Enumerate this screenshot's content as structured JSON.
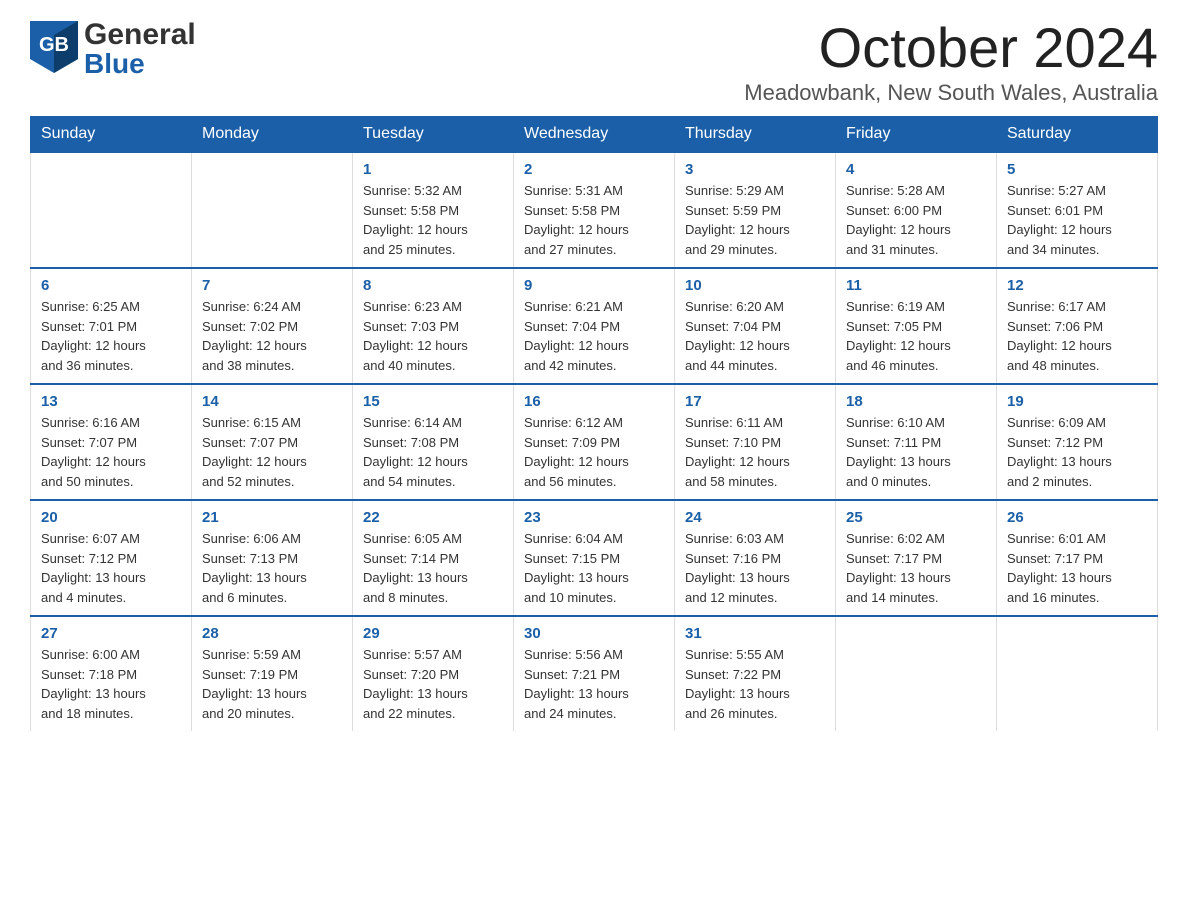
{
  "header": {
    "logo_general": "General",
    "logo_blue": "Blue",
    "month_title": "October 2024",
    "location": "Meadowbank, New South Wales, Australia"
  },
  "days_of_week": [
    "Sunday",
    "Monday",
    "Tuesday",
    "Wednesday",
    "Thursday",
    "Friday",
    "Saturday"
  ],
  "weeks": [
    {
      "days": [
        {
          "number": "",
          "info": ""
        },
        {
          "number": "",
          "info": ""
        },
        {
          "number": "1",
          "info": "Sunrise: 5:32 AM\nSunset: 5:58 PM\nDaylight: 12 hours\nand 25 minutes."
        },
        {
          "number": "2",
          "info": "Sunrise: 5:31 AM\nSunset: 5:58 PM\nDaylight: 12 hours\nand 27 minutes."
        },
        {
          "number": "3",
          "info": "Sunrise: 5:29 AM\nSunset: 5:59 PM\nDaylight: 12 hours\nand 29 minutes."
        },
        {
          "number": "4",
          "info": "Sunrise: 5:28 AM\nSunset: 6:00 PM\nDaylight: 12 hours\nand 31 minutes."
        },
        {
          "number": "5",
          "info": "Sunrise: 5:27 AM\nSunset: 6:01 PM\nDaylight: 12 hours\nand 34 minutes."
        }
      ]
    },
    {
      "days": [
        {
          "number": "6",
          "info": "Sunrise: 6:25 AM\nSunset: 7:01 PM\nDaylight: 12 hours\nand 36 minutes."
        },
        {
          "number": "7",
          "info": "Sunrise: 6:24 AM\nSunset: 7:02 PM\nDaylight: 12 hours\nand 38 minutes."
        },
        {
          "number": "8",
          "info": "Sunrise: 6:23 AM\nSunset: 7:03 PM\nDaylight: 12 hours\nand 40 minutes."
        },
        {
          "number": "9",
          "info": "Sunrise: 6:21 AM\nSunset: 7:04 PM\nDaylight: 12 hours\nand 42 minutes."
        },
        {
          "number": "10",
          "info": "Sunrise: 6:20 AM\nSunset: 7:04 PM\nDaylight: 12 hours\nand 44 minutes."
        },
        {
          "number": "11",
          "info": "Sunrise: 6:19 AM\nSunset: 7:05 PM\nDaylight: 12 hours\nand 46 minutes."
        },
        {
          "number": "12",
          "info": "Sunrise: 6:17 AM\nSunset: 7:06 PM\nDaylight: 12 hours\nand 48 minutes."
        }
      ]
    },
    {
      "days": [
        {
          "number": "13",
          "info": "Sunrise: 6:16 AM\nSunset: 7:07 PM\nDaylight: 12 hours\nand 50 minutes."
        },
        {
          "number": "14",
          "info": "Sunrise: 6:15 AM\nSunset: 7:07 PM\nDaylight: 12 hours\nand 52 minutes."
        },
        {
          "number": "15",
          "info": "Sunrise: 6:14 AM\nSunset: 7:08 PM\nDaylight: 12 hours\nand 54 minutes."
        },
        {
          "number": "16",
          "info": "Sunrise: 6:12 AM\nSunset: 7:09 PM\nDaylight: 12 hours\nand 56 minutes."
        },
        {
          "number": "17",
          "info": "Sunrise: 6:11 AM\nSunset: 7:10 PM\nDaylight: 12 hours\nand 58 minutes."
        },
        {
          "number": "18",
          "info": "Sunrise: 6:10 AM\nSunset: 7:11 PM\nDaylight: 13 hours\nand 0 minutes."
        },
        {
          "number": "19",
          "info": "Sunrise: 6:09 AM\nSunset: 7:12 PM\nDaylight: 13 hours\nand 2 minutes."
        }
      ]
    },
    {
      "days": [
        {
          "number": "20",
          "info": "Sunrise: 6:07 AM\nSunset: 7:12 PM\nDaylight: 13 hours\nand 4 minutes."
        },
        {
          "number": "21",
          "info": "Sunrise: 6:06 AM\nSunset: 7:13 PM\nDaylight: 13 hours\nand 6 minutes."
        },
        {
          "number": "22",
          "info": "Sunrise: 6:05 AM\nSunset: 7:14 PM\nDaylight: 13 hours\nand 8 minutes."
        },
        {
          "number": "23",
          "info": "Sunrise: 6:04 AM\nSunset: 7:15 PM\nDaylight: 13 hours\nand 10 minutes."
        },
        {
          "number": "24",
          "info": "Sunrise: 6:03 AM\nSunset: 7:16 PM\nDaylight: 13 hours\nand 12 minutes."
        },
        {
          "number": "25",
          "info": "Sunrise: 6:02 AM\nSunset: 7:17 PM\nDaylight: 13 hours\nand 14 minutes."
        },
        {
          "number": "26",
          "info": "Sunrise: 6:01 AM\nSunset: 7:17 PM\nDaylight: 13 hours\nand 16 minutes."
        }
      ]
    },
    {
      "days": [
        {
          "number": "27",
          "info": "Sunrise: 6:00 AM\nSunset: 7:18 PM\nDaylight: 13 hours\nand 18 minutes."
        },
        {
          "number": "28",
          "info": "Sunrise: 5:59 AM\nSunset: 7:19 PM\nDaylight: 13 hours\nand 20 minutes."
        },
        {
          "number": "29",
          "info": "Sunrise: 5:57 AM\nSunset: 7:20 PM\nDaylight: 13 hours\nand 22 minutes."
        },
        {
          "number": "30",
          "info": "Sunrise: 5:56 AM\nSunset: 7:21 PM\nDaylight: 13 hours\nand 24 minutes."
        },
        {
          "number": "31",
          "info": "Sunrise: 5:55 AM\nSunset: 7:22 PM\nDaylight: 13 hours\nand 26 minutes."
        },
        {
          "number": "",
          "info": ""
        },
        {
          "number": "",
          "info": ""
        }
      ]
    }
  ]
}
